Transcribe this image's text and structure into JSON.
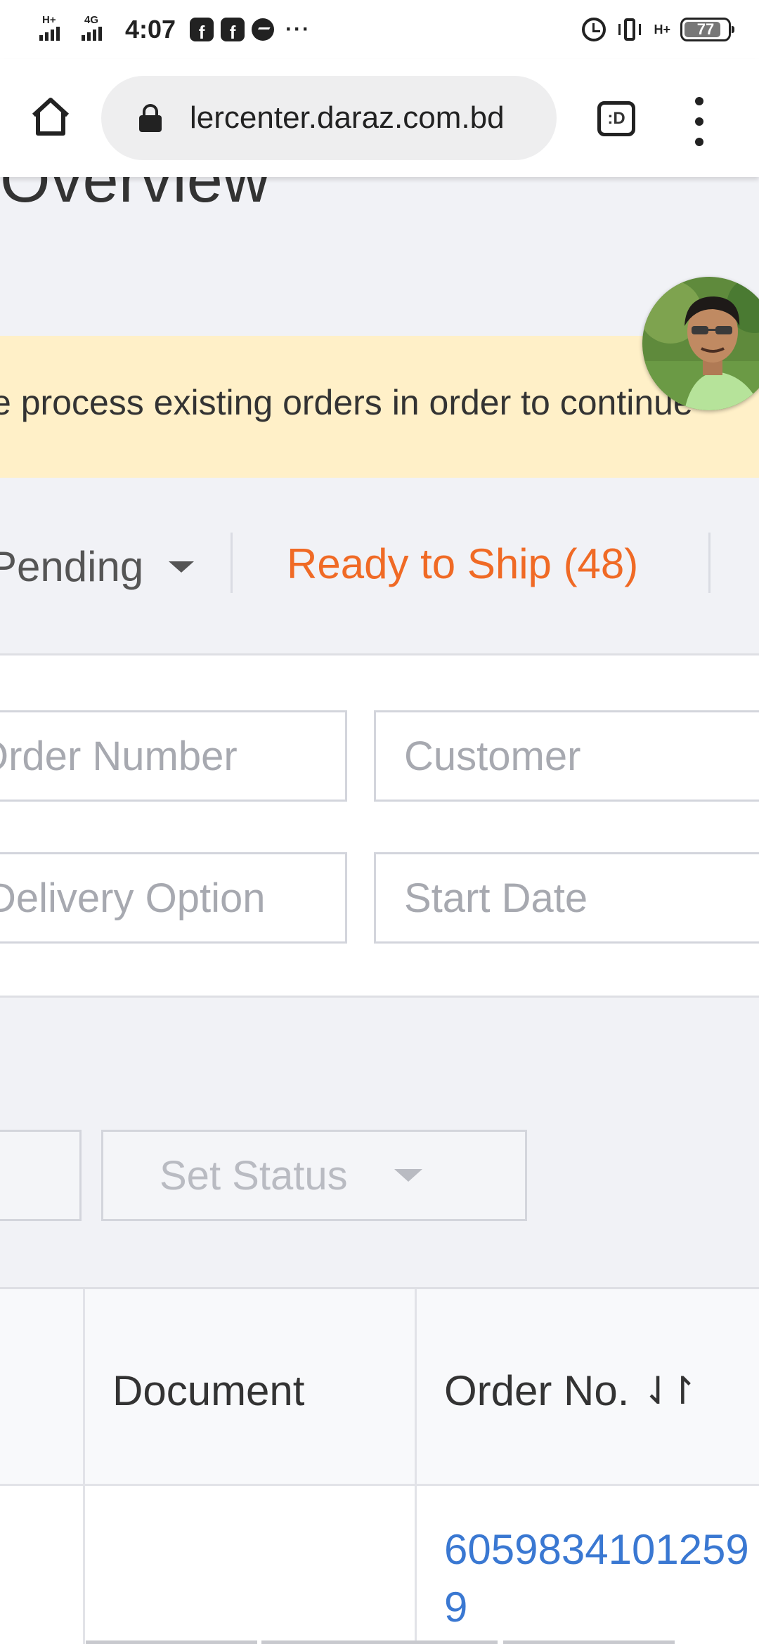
{
  "status_bar": {
    "network_1": "H+",
    "network_2": "4G",
    "time": "4:07",
    "app_icon_1": "facebook-icon",
    "app_icon_2": "facebook-icon",
    "app_icon_3": "messenger-icon",
    "more": "···",
    "mobile_data": "H+",
    "battery_level": "77"
  },
  "browser": {
    "url": "lercenter.daraz.com.bd",
    "tabs_label": ":D"
  },
  "page": {
    "title": "Overview",
    "notice": "e process existing orders in order to continue"
  },
  "tabs": {
    "pending": "Pending",
    "ready_to_ship": "Ready to Ship (48)"
  },
  "filters": {
    "order_number_placeholder": "Order Number",
    "customer_placeholder": "Customer",
    "delivery_option_placeholder": "Delivery Option",
    "start_date_placeholder": "Start Date"
  },
  "actions": {
    "set_status": "Set Status"
  },
  "table": {
    "headers": [
      "Document",
      "Order No."
    ],
    "sort_icon": "⇃↾",
    "rows": [
      {
        "order_no": "60598341012599"
      }
    ]
  },
  "colors": {
    "accent_orange": "#f06a25",
    "link_blue": "#3a78d2",
    "notice_bg": "#fff0c8",
    "page_bg": "#f1f2f6"
  }
}
